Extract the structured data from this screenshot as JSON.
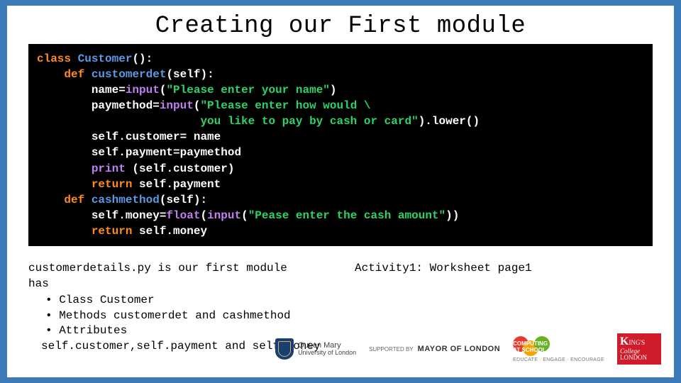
{
  "title": "Creating our First module",
  "code": {
    "l1": {
      "kw": "class",
      "name": "Customer",
      "rest": "():"
    },
    "l2": {
      "kw": "def",
      "name": "customerdet",
      "rest": "(self):"
    },
    "l3": {
      "lhs": "name=",
      "fn": "input",
      "open": "(",
      "str": "\"Please enter your name\"",
      "close": ")"
    },
    "l4": {
      "lhs": "paymethod=",
      "fn": "input",
      "open": "(",
      "str1": "\"Please enter how would \\",
      "str2": "you like to pay by cash or card\"",
      "close": ").lower()"
    },
    "l5": "self.customer= name",
    "l6": "self.payment=paymethod",
    "l7": {
      "fn": "print",
      "rest": " (self.customer)"
    },
    "l8": {
      "kw": "return",
      "rest": " self.payment"
    },
    "l9": {
      "kw": "def",
      "name": "cashmethod",
      "rest": "(self):"
    },
    "l10": {
      "lhs": "self.money=",
      "fn1": "float",
      "open1": "(",
      "fn2": "input",
      "open2": "(",
      "str": "\"Pease enter the cash amount\"",
      "close": "))"
    },
    "l11": {
      "kw": "return",
      "rest": " self.money"
    }
  },
  "desc": {
    "line1a": "customerdetails.py",
    "line1b": " is our first module",
    "line2": "has",
    "b1": "Class Customer",
    "b2": "Methods customerdet and cashmethod",
    "b3a": "Attributes",
    "b3b": "self.customer,self.payment and self.money"
  },
  "activity": "Activity1: Worksheet page1",
  "logos": {
    "qm1": "Queen Mary",
    "qm2": "University of London",
    "mayor1": "SUPPORTED BY",
    "mayor2": "MAYOR OF LONDON",
    "cas1": "COMPUTING AT SCHOOL",
    "cas2": "EDUCATE · ENGAGE · ENCOURAGE",
    "kcl": "ING'S",
    "kcl2": "College",
    "kcl3": "LONDON"
  }
}
